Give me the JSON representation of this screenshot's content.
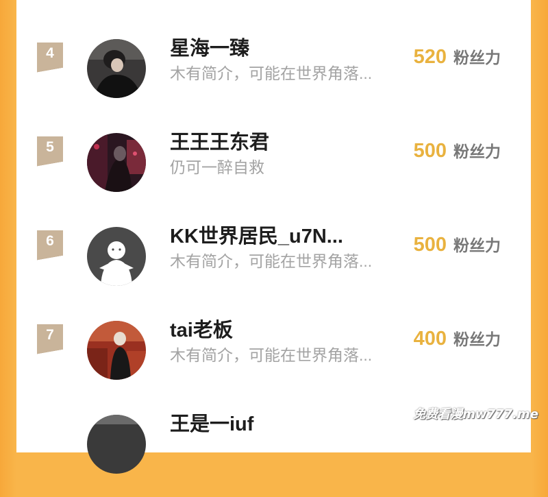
{
  "ranking": {
    "rows": [
      {
        "rank": "4",
        "name": "星海一臻",
        "bio": "木有简介，可能在世界角落...",
        "fans": "520",
        "fans_label": "粉丝力"
      },
      {
        "rank": "5",
        "name": "王王王东君",
        "bio": "仍可一醉自救",
        "fans": "500",
        "fans_label": "粉丝力"
      },
      {
        "rank": "6",
        "name": "KK世界居民_u7N...",
        "bio": "木有简介，可能在世界角落...",
        "fans": "500",
        "fans_label": "粉丝力"
      },
      {
        "rank": "7",
        "name": "tai老板",
        "bio": "木有简介，可能在世界角落...",
        "fans": "400",
        "fans_label": "粉丝力"
      },
      {
        "rank": "",
        "name": "王是一iuf",
        "bio": "",
        "fans": "",
        "fans_label": ""
      }
    ]
  },
  "watermark": "免费看漫mw777.me",
  "colors": {
    "accent": "#f9b54a",
    "fans": "#e9b23f",
    "rank_badge": "#c9b49a"
  }
}
